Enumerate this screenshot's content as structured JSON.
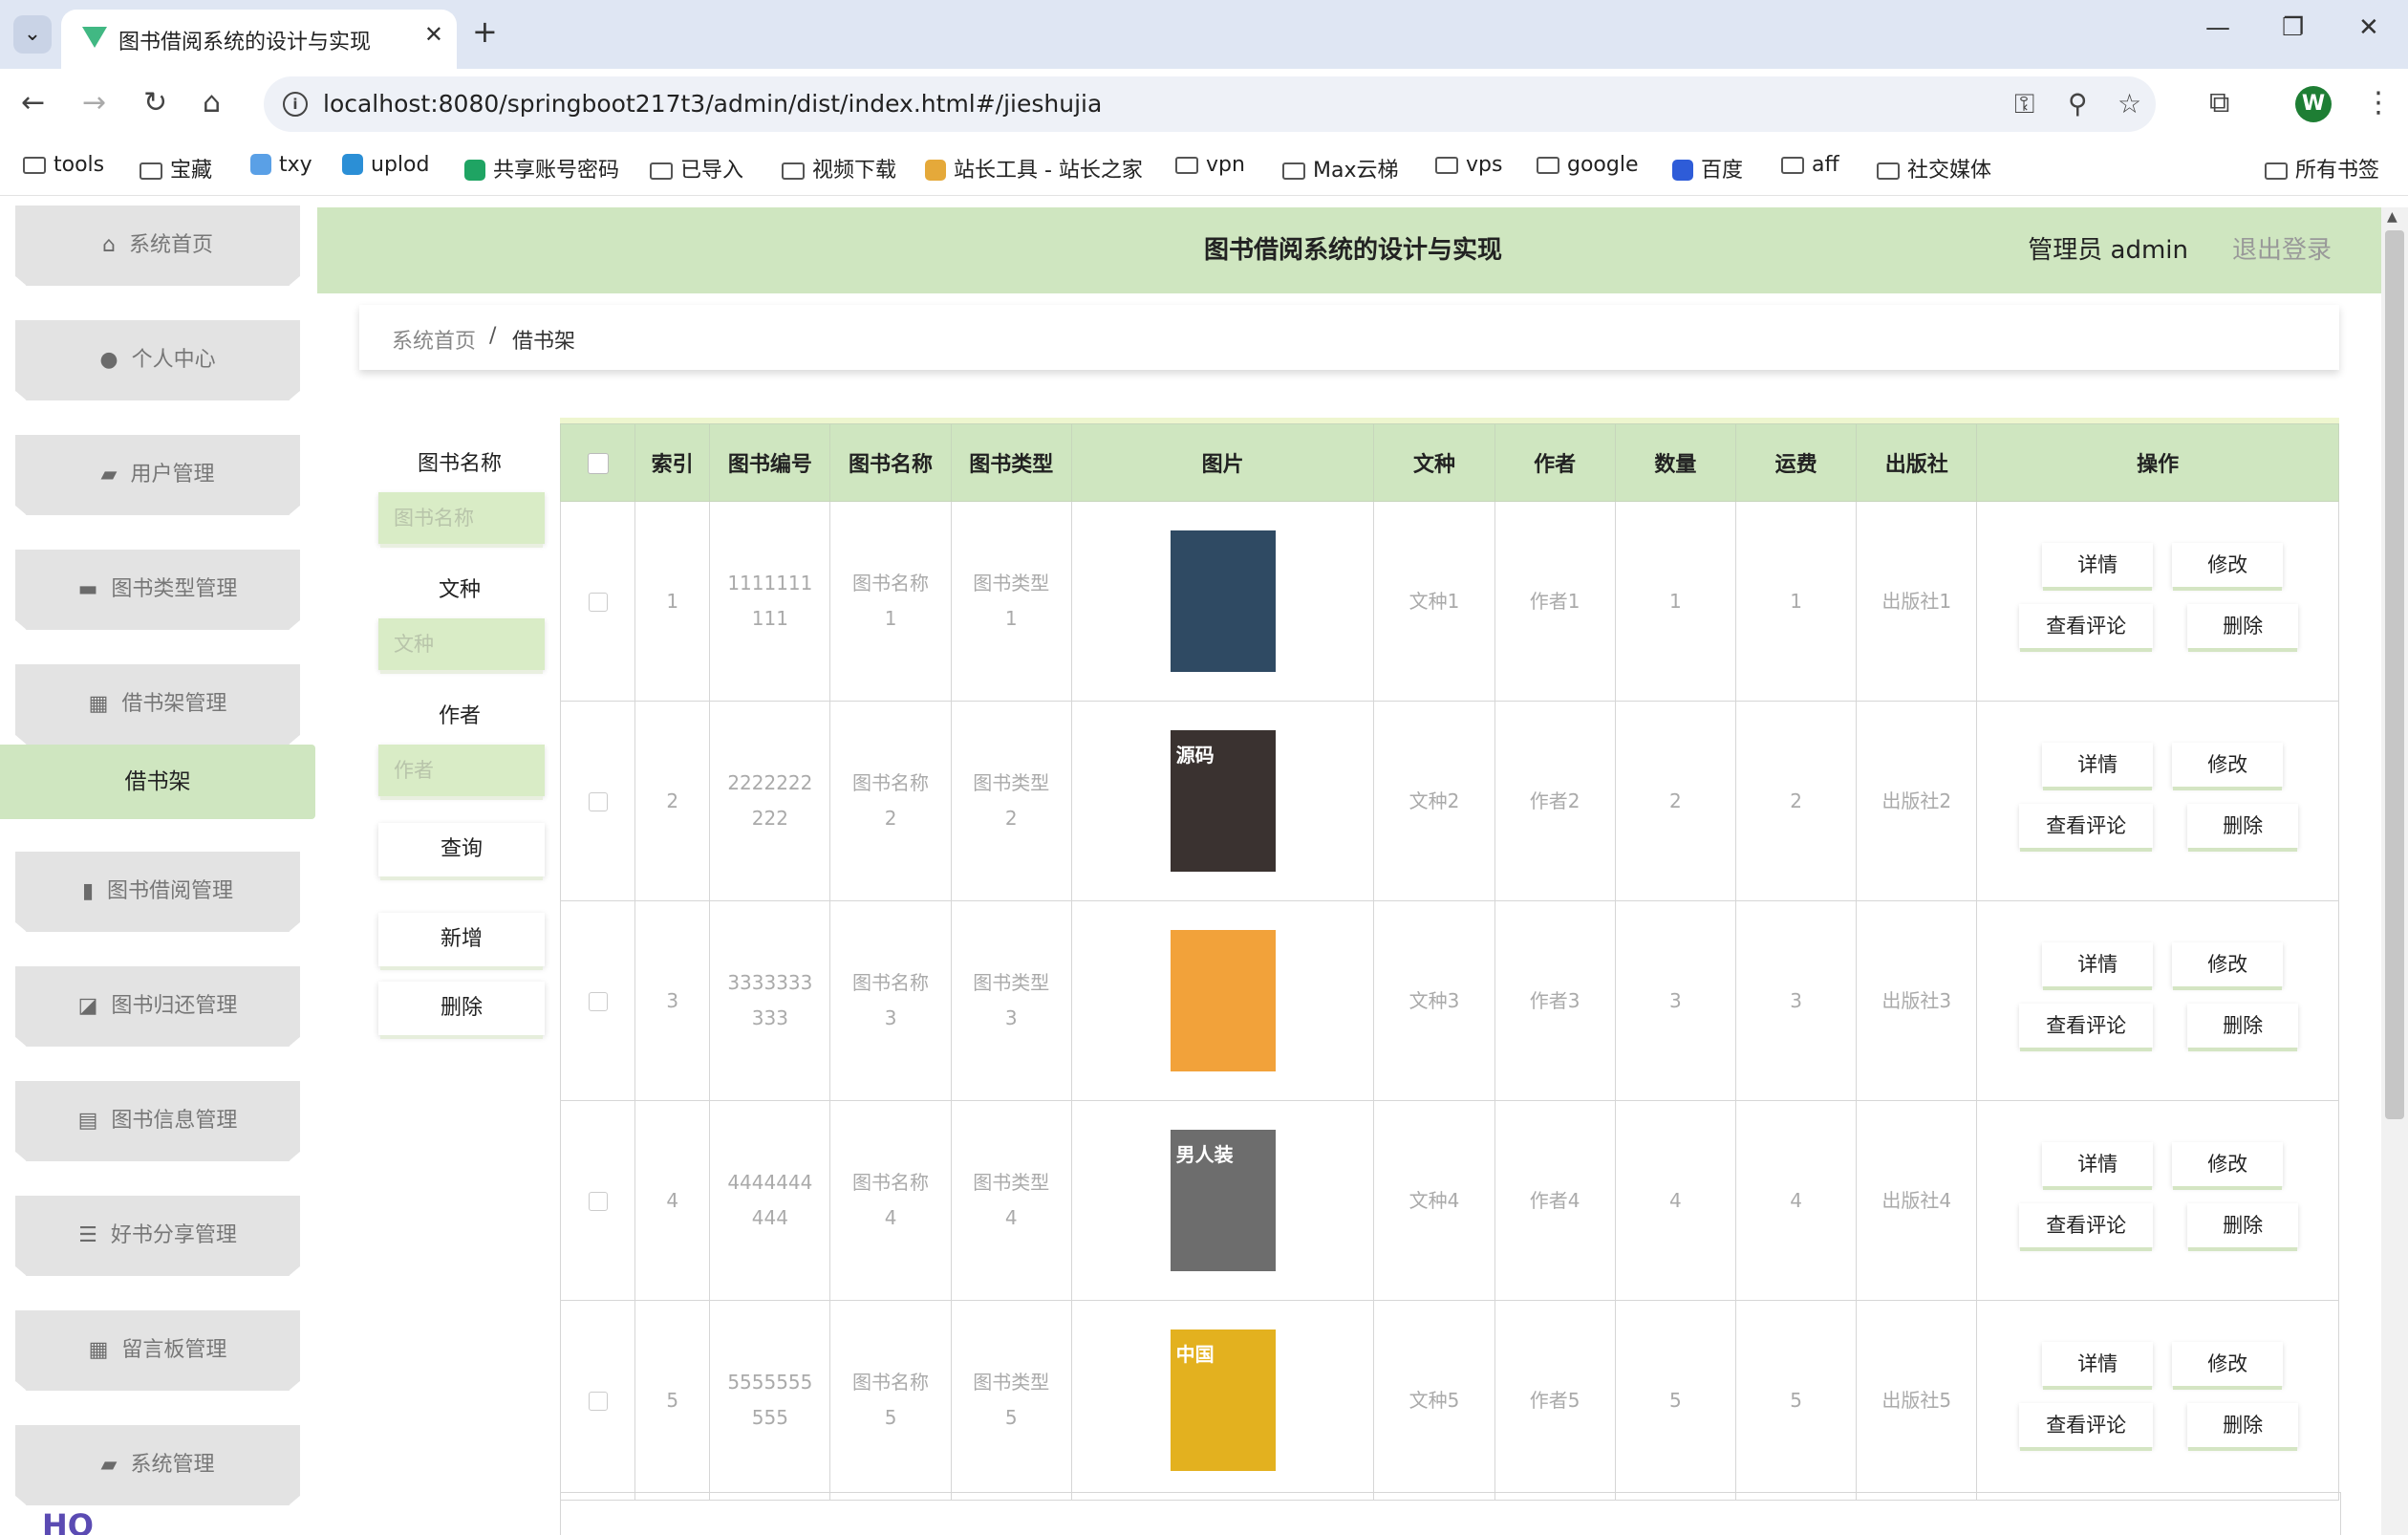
{
  "browser": {
    "tab_title": "图书借阅系统的设计与实现",
    "url": "localhost:8080/springboot217t3/admin/dist/index.html#/jieshujia",
    "profile_initial": "W",
    "bookmarks": [
      "tools",
      "宝藏",
      "txy",
      "uplod",
      "共享账号密码",
      "已导入",
      "视频下载",
      "站长工具 - 站长之家",
      "vpn",
      "Max云梯",
      "vps",
      "google",
      "百度",
      "aff",
      "社交媒体"
    ],
    "all_bookmarks": "所有书签"
  },
  "sidebar": {
    "items": [
      {
        "label": "系统首页",
        "icon": "home-icon"
      },
      {
        "label": "个人中心",
        "icon": "user-icon"
      },
      {
        "label": "用户管理",
        "icon": "user-manage-icon"
      },
      {
        "label": "图书类型管理",
        "icon": "briefcase-icon"
      },
      {
        "label": "借书架管理",
        "icon": "grid-icon"
      },
      {
        "label": "借书架",
        "active_submenu": true
      },
      {
        "label": "图书借阅管理",
        "icon": "bar-chart-icon"
      },
      {
        "label": "图书归还管理",
        "icon": "line-chart-icon"
      },
      {
        "label": "图书信息管理",
        "icon": "clipboard-icon"
      },
      {
        "label": "好书分享管理",
        "icon": "list-icon"
      },
      {
        "label": "留言板管理",
        "icon": "grid-icon"
      },
      {
        "label": "系统管理",
        "icon": "ticket-icon"
      }
    ]
  },
  "header": {
    "title": "图书借阅系统的设计与实现",
    "user": "管理员 admin",
    "logout": "退出登录"
  },
  "breadcrumb": {
    "home": "系统首页",
    "separator": "/",
    "current": "借书架"
  },
  "search": {
    "fields": [
      {
        "label": "图书名称",
        "placeholder": "图书名称"
      },
      {
        "label": "文种",
        "placeholder": "文种"
      },
      {
        "label": "作者",
        "placeholder": "作者"
      }
    ],
    "query_button": "查询",
    "add_button": "新增",
    "delete_button": "删除"
  },
  "table": {
    "headers": [
      "索引",
      "图书编号",
      "图书名称",
      "图书类型",
      "图片",
      "文种",
      "作者",
      "数量",
      "运费",
      "出版社",
      "操作"
    ],
    "rows": [
      {
        "index": "1",
        "code_a": "1111111",
        "code_b": "111",
        "name_a": "图书名称",
        "name_b": "1",
        "type_a": "图书类型",
        "type_b": "1",
        "lang": "文种1",
        "author": "作者1",
        "qty": "1",
        "fee": "1",
        "publisher": "出版社1",
        "cover_color": "#2f4a63"
      },
      {
        "index": "2",
        "code_a": "2222222",
        "code_b": "222",
        "name_a": "图书名称",
        "name_b": "2",
        "type_a": "图书类型",
        "type_b": "2",
        "lang": "文种2",
        "author": "作者2",
        "qty": "2",
        "fee": "2",
        "publisher": "出版社2",
        "cover_color": "#3a3230",
        "cover_text": "源码"
      },
      {
        "index": "3",
        "code_a": "3333333",
        "code_b": "333",
        "name_a": "图书名称",
        "name_b": "3",
        "type_a": "图书类型",
        "type_b": "3",
        "lang": "文种3",
        "author": "作者3",
        "qty": "3",
        "fee": "3",
        "publisher": "出版社3",
        "cover_color": "#f2a23a"
      },
      {
        "index": "4",
        "code_a": "4444444",
        "code_b": "444",
        "name_a": "图书名称",
        "name_b": "4",
        "type_a": "图书类型",
        "type_b": "4",
        "lang": "文种4",
        "author": "作者4",
        "qty": "4",
        "fee": "4",
        "publisher": "出版社4",
        "cover_color": "#6d6d6d",
        "cover_text": "男人装"
      },
      {
        "index": "5",
        "code_a": "5555555",
        "code_b": "555",
        "name_a": "图书名称",
        "name_b": "5",
        "type_a": "图书类型",
        "type_b": "5",
        "lang": "文种5",
        "author": "作者5",
        "qty": "5",
        "fee": "5",
        "publisher": "出版社5",
        "cover_color": "#e3b11f",
        "cover_text": "中国"
      }
    ],
    "actions": {
      "detail": "详情",
      "edit": "修改",
      "comments": "查看评论",
      "delete": "删除"
    }
  },
  "colors": {
    "accent_green": "#cfe6c0",
    "menu_gray": "#e3e3e3"
  }
}
